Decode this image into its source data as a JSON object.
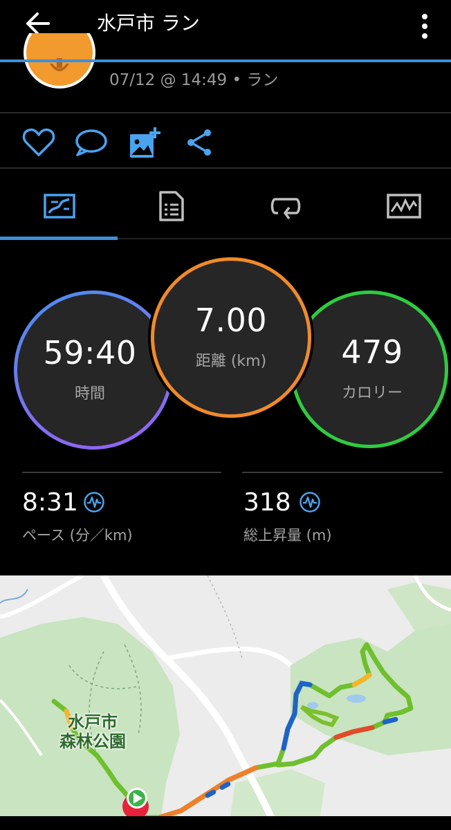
{
  "appbar": {
    "title": "水戸市 ラン"
  },
  "activity": {
    "subtitle": "07/12 @ 14:49 • ラン"
  },
  "rings": {
    "time": {
      "value": "59:40",
      "label": "時間",
      "color": "#5a8cf0"
    },
    "distance": {
      "value": "7.00",
      "label": "距離 (km)",
      "color": "#f08a2a"
    },
    "calories": {
      "value": "479",
      "label": "カロリー",
      "color": "#2ecc40"
    }
  },
  "stats": {
    "pace": {
      "value": "8:31",
      "label": "ペース (分／km)"
    },
    "ascent": {
      "value": "318",
      "label": "総上昇量 (m)"
    }
  },
  "map": {
    "place_line1": "水戸市",
    "place_line2": "森林公園"
  },
  "colors": {
    "accent": "#3d8fd8",
    "background": "#000000"
  }
}
